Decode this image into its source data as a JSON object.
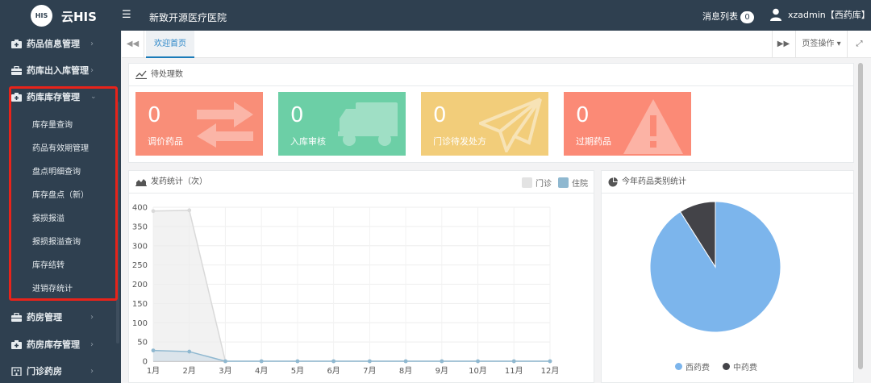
{
  "header": {
    "logo_text": "HIS",
    "brand": "云HIS",
    "hospital": "新致开源医疗医院",
    "messages_label": "消息列表",
    "messages_count": "0",
    "user": "xzadmin【西药库】"
  },
  "sidebar": {
    "items": [
      {
        "label": "药品信息管理",
        "icon": "plus-box-icon"
      },
      {
        "label": "药库出入库管理",
        "icon": "briefcase-icon"
      },
      {
        "label": "药库库存管理",
        "icon": "plus-box-icon"
      },
      {
        "label": "药房管理",
        "icon": "briefcase-icon"
      },
      {
        "label": "药房库存管理",
        "icon": "plus-box-icon"
      },
      {
        "label": "门诊药房",
        "icon": "building-icon"
      }
    ],
    "subitems": [
      "库存量查询",
      "药品有效期管理",
      "盘点明细查询",
      "库存盘点（新）",
      "报损报溢",
      "报损报溢查询",
      "库存结转",
      "进销存统计"
    ]
  },
  "tabs": {
    "active": "欢迎首页",
    "page_ops": "页签操作"
  },
  "pending": {
    "title": "待处理数",
    "cards": [
      {
        "value": "0",
        "label": "调价药品",
        "color": "#f98e78",
        "icon": "exchange-icon"
      },
      {
        "value": "0",
        "label": "入库审核",
        "color": "#6ccfa6",
        "icon": "truck-icon"
      },
      {
        "value": "0",
        "label": "门诊待发处方",
        "color": "#f2cd7a",
        "icon": "paper-plane-icon"
      },
      {
        "value": "0",
        "label": "过期药品",
        "color": "#fb8a76",
        "icon": "warning-icon"
      }
    ]
  },
  "dispense_chart": {
    "title": "发药统计（次）",
    "legend": [
      "门诊",
      "住院"
    ]
  },
  "pie_chart": {
    "title": "今年药品类别统计",
    "legend": [
      "西药费",
      "中药费"
    ]
  },
  "chart_data": [
    {
      "type": "area",
      "title": "发药统计（次）",
      "categories": [
        "1月",
        "2月",
        "3月",
        "4月",
        "5月",
        "6月",
        "7月",
        "8月",
        "9月",
        "10月",
        "11月",
        "12月"
      ],
      "series": [
        {
          "name": "门诊",
          "values": [
            390,
            392,
            0,
            0,
            0,
            0,
            0,
            0,
            0,
            0,
            0,
            0
          ],
          "color": "#d9d9d9"
        },
        {
          "name": "住院",
          "values": [
            28,
            25,
            0,
            0,
            0,
            0,
            0,
            0,
            0,
            0,
            0,
            0
          ],
          "color": "#8fb8d0"
        }
      ],
      "ylim": [
        0,
        400
      ],
      "yticks": [
        0,
        50,
        100,
        150,
        200,
        250,
        300,
        350,
        400
      ],
      "grid": true,
      "legend_position": "top-right"
    },
    {
      "type": "pie",
      "title": "今年药品类别统计",
      "slices": [
        {
          "name": "西药费",
          "value": 91,
          "color": "#7cb5ec"
        },
        {
          "name": "中药费",
          "value": 9,
          "color": "#434348"
        }
      ],
      "legend_position": "bottom"
    }
  ]
}
